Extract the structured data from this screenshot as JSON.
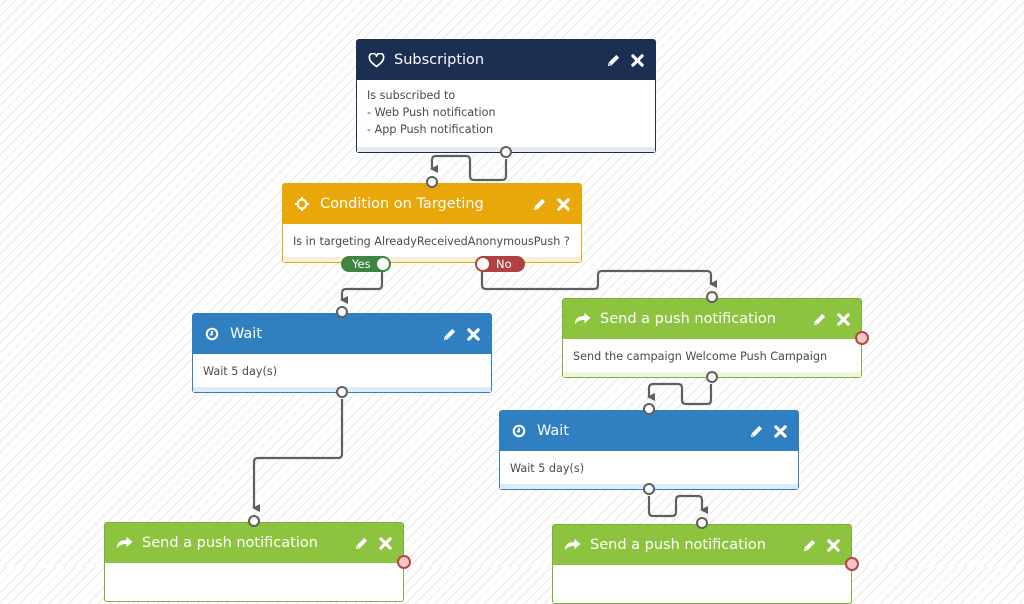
{
  "colors": {
    "subscription": "#1b2f52",
    "condition": "#e9a709",
    "wait": "#2f7fc1",
    "push": "#8cc43f",
    "yes": "#3d8540",
    "no": "#b04042",
    "connector": "#5f5f5f"
  },
  "nodes": {
    "subscription": {
      "icon": "heart-icon",
      "title": "Subscription",
      "lines": [
        "Is subscribed to",
        "- Web Push notification",
        "- App Push notification"
      ]
    },
    "condition": {
      "icon": "crosshair-icon",
      "title": "Condition on Targeting",
      "lines": [
        "Is in targeting AlreadyReceivedAnonymousPush ?"
      ],
      "yes_label": "Yes",
      "no_label": "No"
    },
    "wait_left": {
      "icon": "clock-icon",
      "title": "Wait",
      "lines": [
        "Wait 5 day(s)"
      ]
    },
    "push_right": {
      "icon": "share-arrow-icon",
      "title": "Send a push notification",
      "lines": [
        "Send the campaign Welcome Push Campaign"
      ]
    },
    "wait_right": {
      "icon": "clock-icon",
      "title": "Wait",
      "lines": [
        "Wait 5 day(s)"
      ]
    },
    "push_bottom_left": {
      "icon": "share-arrow-icon",
      "title": "Send a push notification",
      "lines": []
    },
    "push_bottom_right": {
      "icon": "share-arrow-icon",
      "title": "Send a push notification",
      "lines": []
    }
  },
  "actions": {
    "edit": "pencil-icon",
    "delete": "close-icon"
  }
}
